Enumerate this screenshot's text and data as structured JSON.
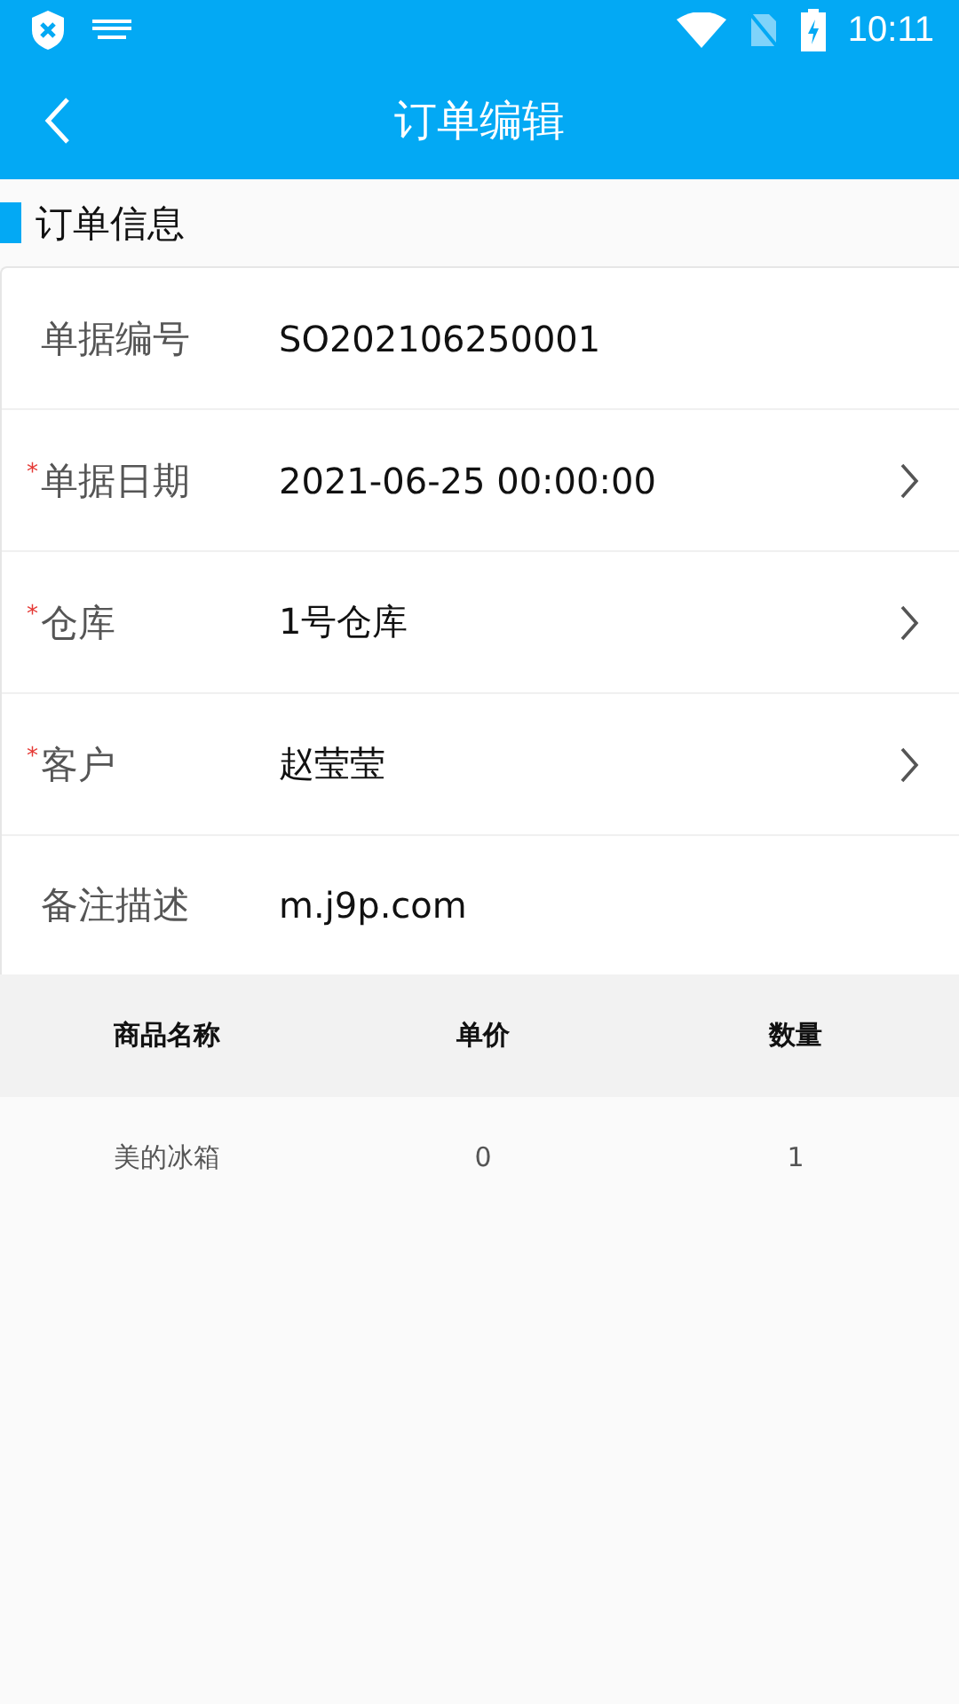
{
  "status_bar": {
    "time": "10:11"
  },
  "header": {
    "title": "订单编辑"
  },
  "section": {
    "title": "订单信息"
  },
  "fields": [
    {
      "label": "单据编号",
      "value": "SO202106250001",
      "kind": "text"
    },
    {
      "required_mark": "*",
      "label": "单据日期",
      "value": "2021-06-25 00:00:00",
      "kind": "picker"
    },
    {
      "required_mark": "*",
      "label": "仓库",
      "value": "1号仓库",
      "kind": "picker"
    },
    {
      "required_mark": "*",
      "label": "客户",
      "value": "赵莹莹",
      "kind": "picker"
    },
    {
      "label": "备注描述",
      "value": "m.j9p.com",
      "kind": "text"
    }
  ],
  "table": {
    "columns": [
      "商品名称",
      "单价",
      "数量"
    ],
    "rows": [
      [
        "美的冰箱",
        "0",
        "1"
      ]
    ]
  }
}
